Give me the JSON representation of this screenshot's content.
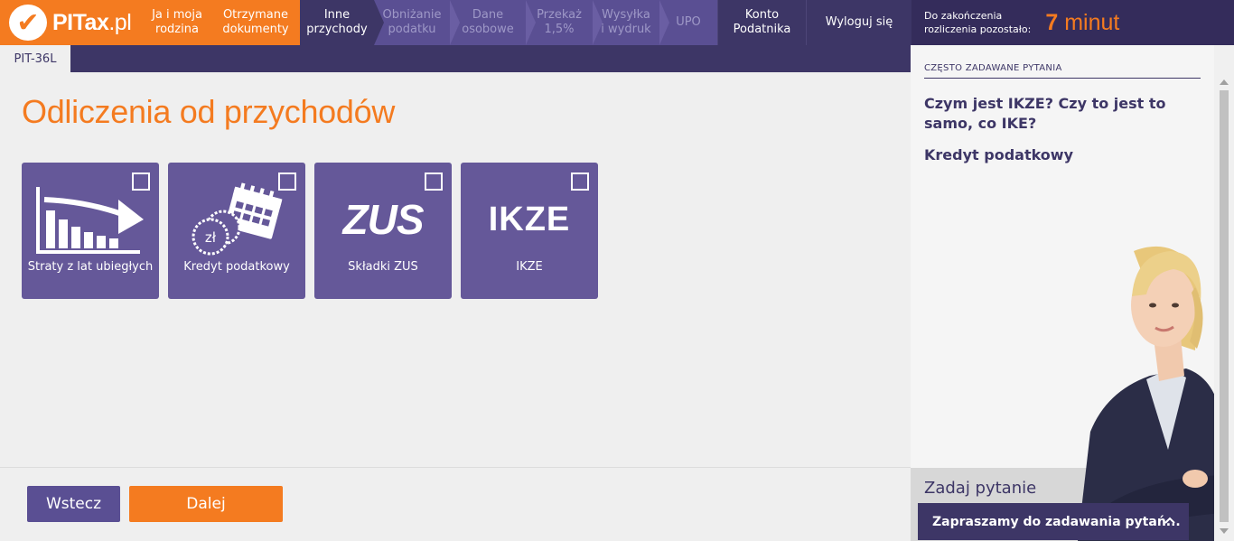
{
  "header": {
    "logo": {
      "mark": "✔",
      "text_bold": "PITax",
      "text_thin": ".pl"
    },
    "steps": [
      {
        "label": "Ja i moja\nrodzina",
        "state": "done"
      },
      {
        "label": "Otrzymane\ndokumenty",
        "state": "done"
      },
      {
        "label": "Inne\nprzychody",
        "state": "active"
      },
      {
        "label": "Obniżanie\npodatku",
        "state": "disabled"
      },
      {
        "label": "Dane\nosobowe",
        "state": "disabled"
      },
      {
        "label": "Przekaż\n1,5%",
        "state": "disabled"
      },
      {
        "label": "Wysyłka\ni wydruk",
        "state": "disabled"
      },
      {
        "label": "UPO",
        "state": "disabled"
      }
    ],
    "account_label": "Konto\nPodatnika",
    "logout_label": "Wyloguj się",
    "timer": {
      "label": "Do zakończenia\nrozliczenia pozostało:",
      "value_number": "7",
      "value_unit": "minut"
    }
  },
  "form_tab": "PIT-36L",
  "main": {
    "title": "Odliczenia od przychodów",
    "tiles": [
      {
        "label": "Straty z lat ubiegłych",
        "icon": "chart-arrow-icon",
        "checked": false
      },
      {
        "label": "Kredyt podatkowy",
        "icon": "calendar-coins-icon",
        "checked": false,
        "icon_text": "zł"
      },
      {
        "label": "Składki ZUS",
        "icon": "zus-logo-icon",
        "checked": false,
        "icon_text": "ZUS"
      },
      {
        "label": "IKZE",
        "icon": "ikze-logo-icon",
        "checked": false,
        "icon_text": "IKZE"
      }
    ],
    "back_label": "Wstecz",
    "next_label": "Dalej"
  },
  "sidebar": {
    "faq_heading": "CZĘSTO ZADAWANE PYTANIA",
    "faq_items": [
      "Czym jest IKZE? Czy to jest to samo, co IKE?",
      "Kredyt podatkowy"
    ],
    "ask_label": "Zadaj pytanie",
    "chat_label": "Zapraszamy do zadawania pytań...",
    "chat_chevron": "^"
  },
  "colors": {
    "brand_orange": "#f47b20",
    "brand_purple": "#3d3666",
    "tile_purple": "#655899"
  }
}
